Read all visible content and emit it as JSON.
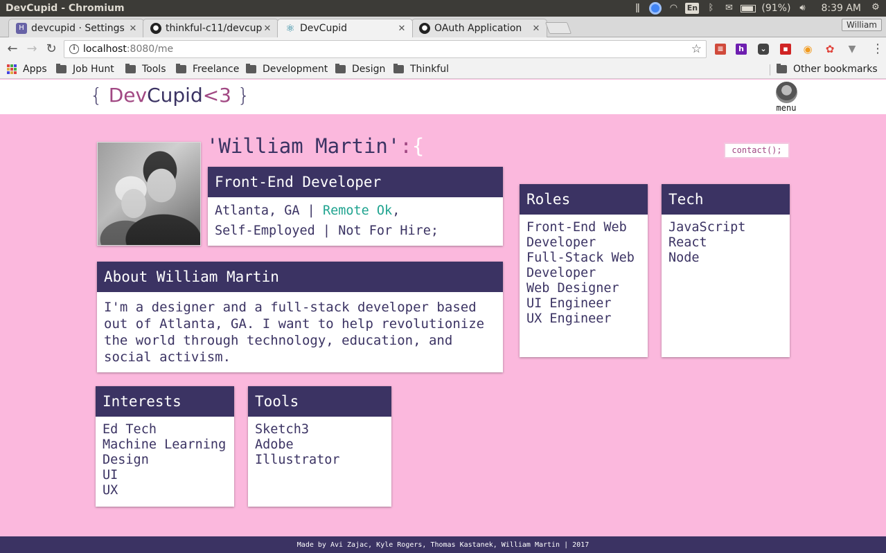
{
  "os": {
    "window_title": "DevCupid - Chromium",
    "lang": "En",
    "battery": "(91%)",
    "time": "8:39 AM"
  },
  "browser": {
    "tabs": [
      {
        "label": "devcupid · Settings",
        "favicon": "heroku-icon",
        "color": "#6762a6"
      },
      {
        "label": "thinkful-c11/devcup",
        "favicon": "github-icon",
        "color": "#222"
      },
      {
        "label": "DevCupid",
        "favicon": "react-icon",
        "color": "#1a7f9a"
      },
      {
        "label": "OAuth Application",
        "favicon": "github-icon",
        "color": "#222"
      }
    ],
    "active_tab": 2,
    "profile": "William",
    "url_host": "localhost",
    "url_path": ":8080/me",
    "bookmarks": [
      "Apps",
      "Job Hunt",
      "Tools",
      "Freelance",
      "Development",
      "Design",
      "Thinkful"
    ],
    "other_bookmarks": "Other bookmarks"
  },
  "site": {
    "logo": {
      "open": "{",
      "dev": "Dev",
      "cupid": "Cupid",
      "heart": "<3",
      "close": "}"
    },
    "menu_label": "menu",
    "footer": "Made by Avi Zajac, Kyle Rogers, Thomas Kastanek, William Martin | 2017"
  },
  "profile": {
    "name_prefix": "'William Martin'",
    "name_colon": ":",
    "name_brace": "{",
    "contact_label": "contact();",
    "headline": "Front-End Developer",
    "location": "Atlanta, GA",
    "remote": "Remote Ok",
    "employment": "Self-Employed",
    "hire_status": "Not For Hire;",
    "about_title": "About William Martin",
    "about_text": "I'm a designer and a full-stack developer based out of Atlanta, GA. I want to help revolutionize the world through technology, education, and social activism.",
    "roles_title": "Roles",
    "roles": [
      "Front-End Web Developer",
      "Full-Stack Web Developer",
      "Web Designer",
      "UI Engineer",
      "UX Engineer"
    ],
    "tech_title": "Tech",
    "tech": [
      "JavaScript",
      "React",
      "Node"
    ],
    "interests_title": "Interests",
    "interests": [
      "Ed Tech",
      "Machine Learning",
      "Design",
      "UI",
      "UX"
    ],
    "tools_title": "Tools",
    "tools": [
      "Sketch3",
      "Adobe Illustrator"
    ]
  },
  "colors": {
    "page_bg": "#fbb8dd",
    "brand_dark": "#3b3363",
    "brand_pink": "#a14883",
    "remote_green": "#1fa38f"
  }
}
